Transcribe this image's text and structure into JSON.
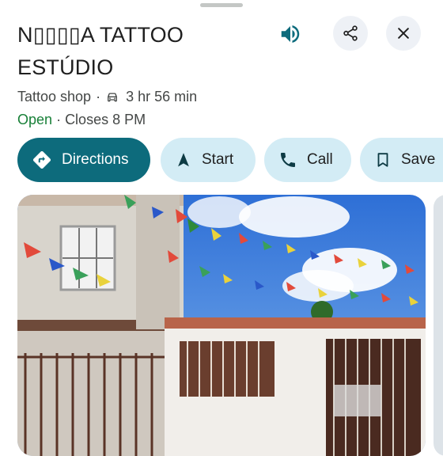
{
  "place": {
    "name": "N▯▯▯▯A TATTOO ESTÚDIO",
    "category": "Tattoo shop",
    "drive_time": "3 hr 56 min",
    "status": "Open",
    "closes": "Closes 8 PM"
  },
  "actions": {
    "directions": "Directions",
    "start": "Start",
    "call": "Call",
    "save": "Save"
  },
  "icons": [
    "speaker-icon",
    "share-icon",
    "close-icon",
    "car-icon",
    "directions-icon",
    "navigation-arrow-icon",
    "phone-icon",
    "bookmark-icon"
  ],
  "colors": {
    "primary_chip": "#0d6b7c",
    "secondary_chip": "#d3ecf5",
    "open_status": "#188038",
    "accent_icon": "#0d6b7c"
  }
}
